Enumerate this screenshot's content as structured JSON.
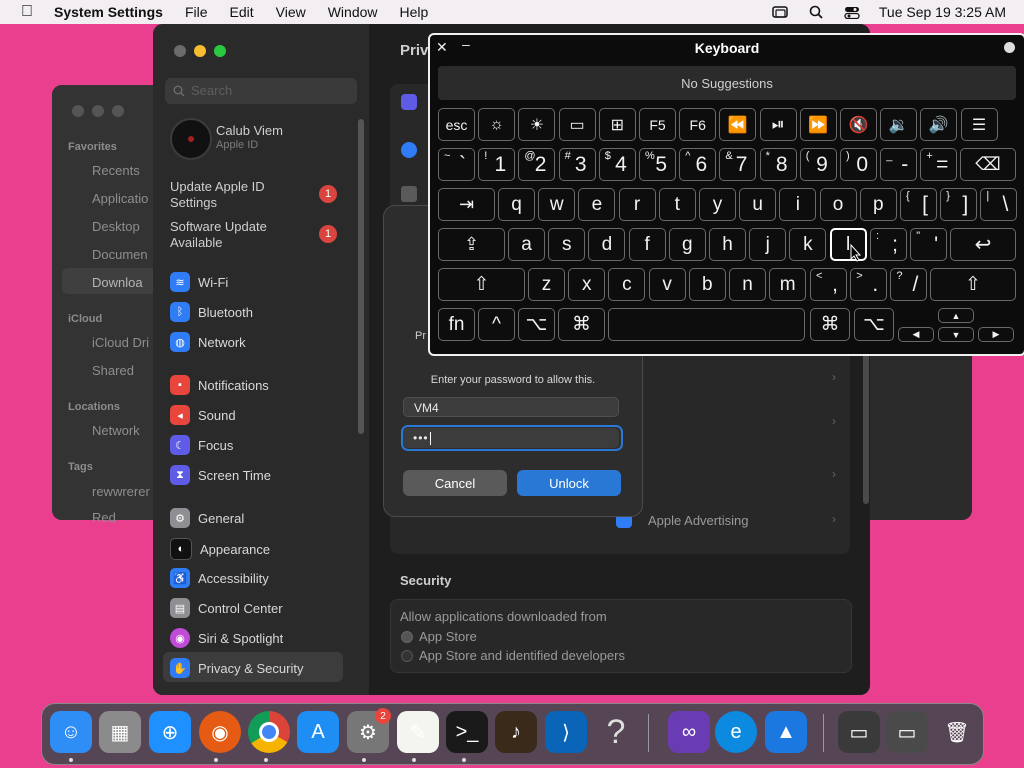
{
  "menubar": {
    "app_name": "System Settings",
    "items": [
      "File",
      "Edit",
      "View",
      "Window",
      "Help"
    ],
    "datetime": "Tue Sep 19  3:25 AM"
  },
  "finder": {
    "favorites_header": "Favorites",
    "favorites": [
      "Recents",
      "Applicatio",
      "Desktop",
      "Documen",
      "Downloa"
    ],
    "icloud_header": "iCloud",
    "icloud": [
      "iCloud Dri",
      "Shared"
    ],
    "locations_header": "Locations",
    "locations": [
      "Network"
    ],
    "tags_header": "Tags",
    "tags": [
      "rewwrerer",
      "Red"
    ]
  },
  "settings": {
    "search_placeholder": "Search",
    "title_partial": "Priv",
    "user_name": "Calub Viem",
    "user_sub": "Apple ID",
    "update_apple_id": "Update Apple ID Settings",
    "software_update": "Software Update Available",
    "badge_count": "1",
    "sidebar": [
      {
        "label": "Wi-Fi",
        "color": "#2f7cf6",
        "icon": "wifi-icon"
      },
      {
        "label": "Bluetooth",
        "color": "#2f7cf6",
        "icon": "bluetooth-icon"
      },
      {
        "label": "Network",
        "color": "#2f7cf6",
        "icon": "globe-icon"
      },
      {
        "label": "Notifications",
        "color": "#e8453c",
        "icon": "bell-icon"
      },
      {
        "label": "Sound",
        "color": "#e8453c",
        "icon": "speaker-icon"
      },
      {
        "label": "Focus",
        "color": "#5e5ce6",
        "icon": "moon-icon"
      },
      {
        "label": "Screen Time",
        "color": "#5e5ce6",
        "icon": "hourglass-icon"
      },
      {
        "label": "General",
        "color": "#8e8e93",
        "icon": "gear-icon"
      },
      {
        "label": "Appearance",
        "color": "#1c1c1e",
        "icon": "appearance-icon"
      },
      {
        "label": "Accessibility",
        "color": "#2f7cf6",
        "icon": "accessibility-icon"
      },
      {
        "label": "Control Center",
        "color": "#8e8e93",
        "icon": "control-center-icon"
      },
      {
        "label": "Siri & Spotlight",
        "color": "#c04bd6",
        "icon": "siri-icon"
      },
      {
        "label": "Privacy & Security",
        "color": "#2f7cf6",
        "icon": "hand-icon"
      }
    ],
    "apple_advertising": "Apple Advertising",
    "security_header": "Security",
    "allow_label": "Allow applications downloaded from",
    "radio_app_store": "App Store",
    "radio_identified": "App Store and identified developers"
  },
  "dialog": {
    "partial_prefix": "Pr",
    "prompt": "Enter your password to allow this.",
    "username": "VM4",
    "password_mask": "•••",
    "cancel": "Cancel",
    "unlock": "Unlock"
  },
  "keyboard": {
    "title": "Keyboard",
    "suggestions": "No Suggestions",
    "row1": [
      "esc",
      "☼",
      "☀",
      "▭",
      "⊞",
      "F5",
      "F6",
      "⏪",
      "⏯",
      "⏩",
      "🔇",
      "🔉",
      "🔊",
      "☰"
    ],
    "row2": [
      [
        "~",
        "`"
      ],
      [
        "!",
        "1"
      ],
      [
        "@",
        "2"
      ],
      [
        "#",
        "3"
      ],
      [
        "$",
        "4"
      ],
      [
        "%",
        "5"
      ],
      [
        "^",
        "6"
      ],
      [
        "&",
        "7"
      ],
      [
        "*",
        "8"
      ],
      [
        "(",
        "9"
      ],
      [
        ")",
        "0"
      ],
      [
        "_",
        "-"
      ],
      [
        "+",
        "="
      ]
    ],
    "backspace": "⌫",
    "tab": "⇥",
    "row3": [
      "q",
      "w",
      "e",
      "r",
      "t",
      "y",
      "u",
      "i",
      "o",
      "p"
    ],
    "row3_sym": [
      [
        "{",
        "["
      ],
      [
        "}",
        "]"
      ],
      [
        "|",
        "\\"
      ]
    ],
    "caps": "⇪",
    "row4": [
      "a",
      "s",
      "d",
      "f",
      "g",
      "h",
      "j",
      "k",
      "l"
    ],
    "row4_sym": [
      [
        ":",
        ";"
      ],
      [
        "\"",
        "'"
      ]
    ],
    "return": "↩",
    "shift": "⇧",
    "row5": [
      "z",
      "x",
      "c",
      "v",
      "b",
      "n",
      "m"
    ],
    "row5_sym": [
      [
        "<",
        ","
      ],
      [
        ">",
        "."
      ],
      [
        "?",
        "/"
      ]
    ],
    "fn": "fn",
    "ctrl": "^",
    "opt": "⌥",
    "cmd": "⌘",
    "up": "▲",
    "down": "▼",
    "left": "◀",
    "right": "▶"
  },
  "dock": {
    "settings_badge": "2",
    "apps": [
      "Finder",
      "Launchpad",
      "Safari",
      "Firefox",
      "Chrome",
      "App Store",
      "System Settings",
      "TextEdit",
      "Terminal",
      "Instruments",
      "VS Code",
      "Help",
      "Visual Studio",
      "Edge",
      "Keynote",
      "Window 1",
      "Window 2",
      "Trash"
    ]
  }
}
